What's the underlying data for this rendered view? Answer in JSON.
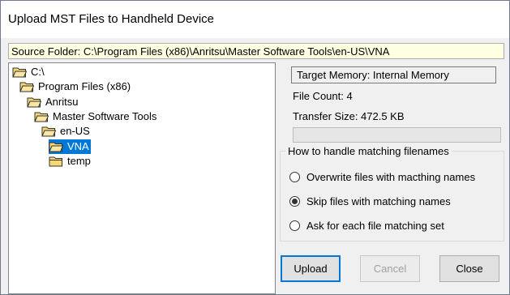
{
  "window": {
    "title": "Upload MST Files to Handheld Device"
  },
  "source_folder": "Source Folder: C:\\Program Files (x86)\\Anritsu\\Master Software Tools\\en-US\\VNA",
  "tree": {
    "items": [
      {
        "label": "C:\\",
        "depth": 0,
        "selected": false,
        "open": true
      },
      {
        "label": "Program Files (x86)",
        "depth": 1,
        "selected": false,
        "open": true
      },
      {
        "label": "Anritsu",
        "depth": 2,
        "selected": false,
        "open": true
      },
      {
        "label": "Master Software Tools",
        "depth": 3,
        "selected": false,
        "open": true
      },
      {
        "label": "en-US",
        "depth": 4,
        "selected": false,
        "open": true
      },
      {
        "label": "VNA",
        "depth": 5,
        "selected": true,
        "open": true
      },
      {
        "label": "temp",
        "depth": 5,
        "selected": false,
        "open": false
      }
    ]
  },
  "info": {
    "target_memory": "Target Memory: Internal Memory",
    "file_count": "File Count: 4",
    "transfer_size": "Transfer Size: 472.5 KB",
    "progress": 0
  },
  "matching": {
    "legend": "How to handle matching filenames",
    "options": [
      {
        "label": "Overwrite files with macthing names",
        "checked": false
      },
      {
        "label": "Skip files with matching names",
        "checked": true
      },
      {
        "label": "Ask for each file matching set",
        "checked": false
      }
    ]
  },
  "buttons": {
    "upload": "Upload",
    "cancel": "Cancel",
    "close": "Close"
  },
  "colors": {
    "selection": "#0078d7",
    "folder": "#f8d775",
    "source_bar_bg": "#ffffe1"
  }
}
